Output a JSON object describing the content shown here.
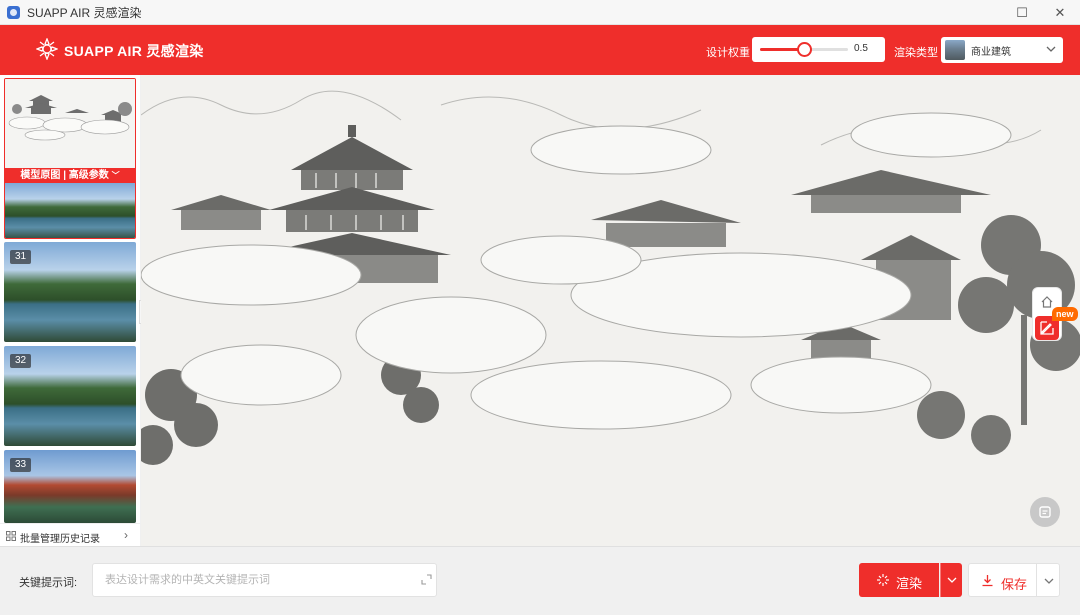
{
  "window": {
    "title": "SUAPP AIR 灵感渲染",
    "maximize_glyph": "☐",
    "close_glyph": "✕"
  },
  "header": {
    "brand": "SUAPP AIR 灵感渲染",
    "design_weight": {
      "label": "设计权重",
      "value": "0.5",
      "level": 0.5
    },
    "render_type": {
      "label": "渲染类型",
      "value": "商业建筑"
    }
  },
  "sidebar": {
    "main_thumb_label": "模型原图 | 高级参数",
    "main_thumb_chevron": "﹀",
    "thumbnails": [
      {
        "number": "31"
      },
      {
        "number": "32"
      },
      {
        "number": "33"
      }
    ],
    "history": {
      "label": "批量管理历史记录",
      "chevron": "›"
    }
  },
  "canvas": {
    "new_badge": "new"
  },
  "bottom": {
    "keyword_label": "关键提示词:",
    "keyword_placeholder": "表达设计需求的中英文关键提示词",
    "keyword_value": "",
    "render_label": "渲染",
    "save_label": "保存"
  },
  "colors": {
    "brand": "#ef2e2b",
    "badge": "#ff6a00"
  },
  "icons": [
    "app-icon",
    "maximize-icon",
    "close-icon",
    "logo-icon",
    "chevron-down-icon",
    "grid-icon",
    "chevron-right-icon",
    "home-icon",
    "edit-icon",
    "chat-icon",
    "expand-icon",
    "sparkle-icon",
    "download-icon"
  ]
}
